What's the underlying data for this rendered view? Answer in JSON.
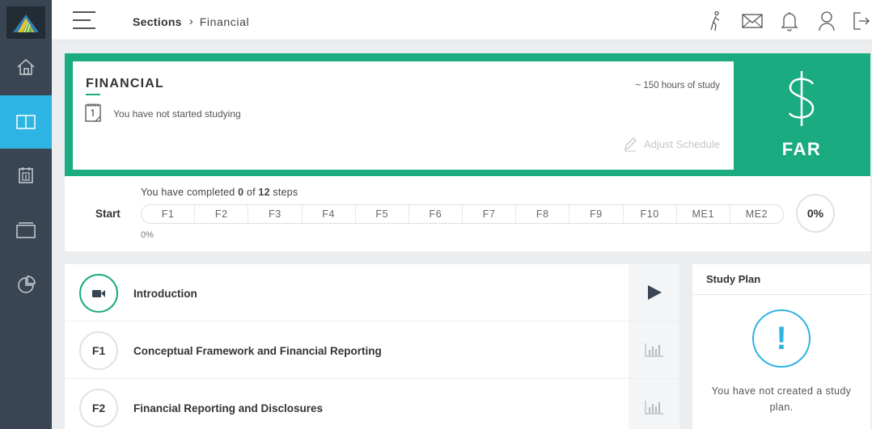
{
  "header": {
    "breadcrumb": {
      "root": "Sections",
      "separator": "›",
      "current": "Financial"
    }
  },
  "sidebar": {
    "items": [
      {
        "icon": "home-icon",
        "active": false
      },
      {
        "icon": "book-icon",
        "active": true
      },
      {
        "icon": "calendar-icon",
        "active": false
      },
      {
        "icon": "cards-icon",
        "active": false
      },
      {
        "icon": "pie-chart-icon",
        "active": false
      }
    ]
  },
  "topbar_icons": [
    "walking-person-icon",
    "mail-icon",
    "bell-icon",
    "user-icon",
    "logout-icon"
  ],
  "section": {
    "title": "FINANCIAL",
    "status": "You have not started studying",
    "hours": "~ 150 hours of study",
    "adjust_label": "Adjust Schedule",
    "code": "FAR",
    "symbol": "$"
  },
  "progress": {
    "prefix": "You have completed ",
    "completed": "0",
    "middle": " of ",
    "total": "12",
    "suffix": " steps",
    "start_label": "Start",
    "steps": [
      "F1",
      "F2",
      "F3",
      "F4",
      "F5",
      "F6",
      "F7",
      "F8",
      "F9",
      "F10",
      "ME1",
      "ME2"
    ],
    "percent_small": "0%",
    "percent": "0%"
  },
  "lessons": [
    {
      "badge": "",
      "icon": "video-camera-icon",
      "title": "Introduction",
      "action": "play-icon"
    },
    {
      "badge": "F1",
      "title": "Conceptual Framework and Financial Reporting",
      "action": "bar-chart-icon"
    },
    {
      "badge": "F2",
      "title": "Financial Reporting and Disclosures",
      "action": "bar-chart-icon"
    }
  ],
  "study_plan": {
    "title": "Study Plan",
    "alert_symbol": "!",
    "message": "You have not created a study plan."
  },
  "colors": {
    "sidebar": "#394552",
    "accent_blue": "#2eb4e3",
    "accent_green": "#1aab80"
  }
}
